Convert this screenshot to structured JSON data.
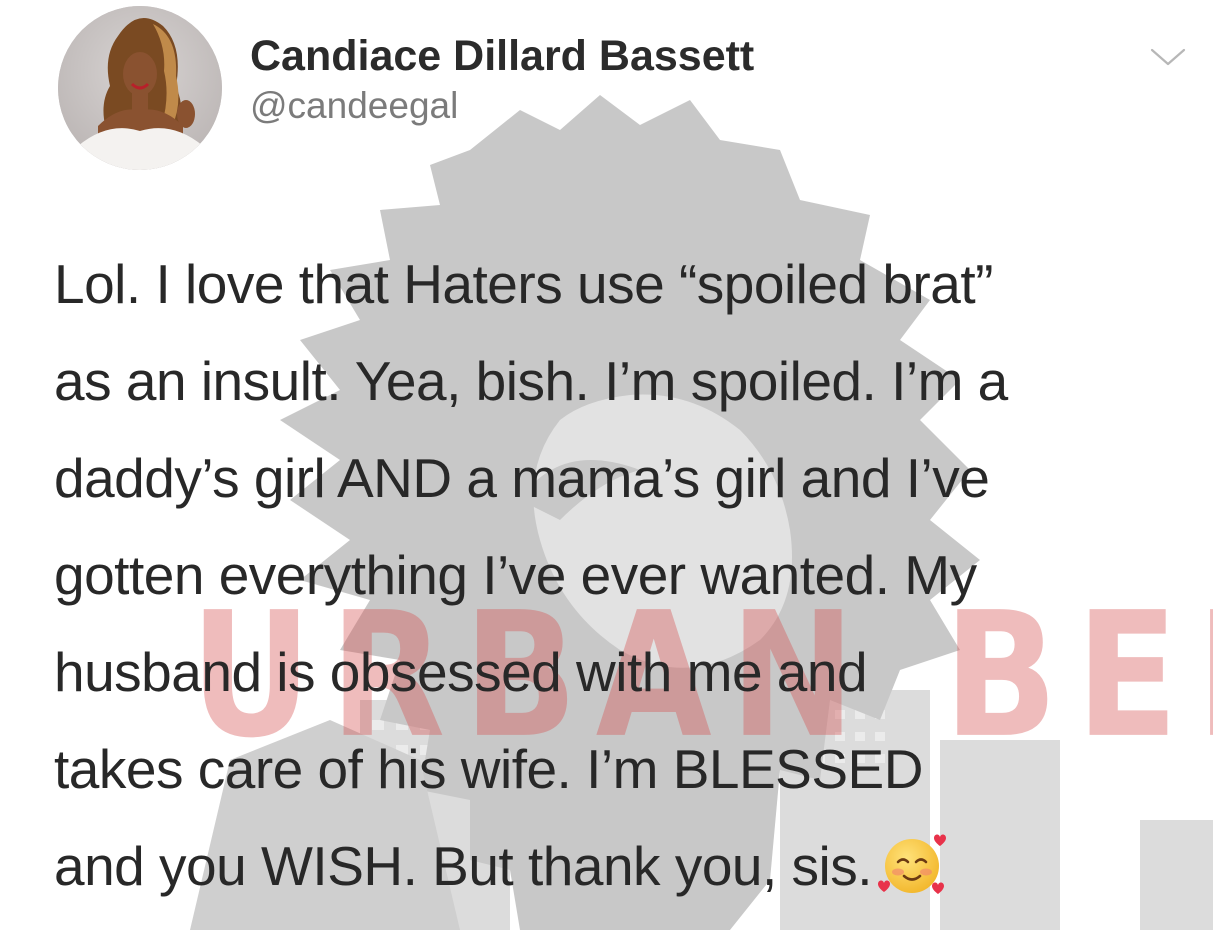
{
  "author": {
    "display_name": "Candiace Dillard Bassett",
    "handle": "@candeegal"
  },
  "tweet": {
    "lines": [
      "Lol. I love that Haters use “spoiled brat”",
      "as an insult. Yea, bish. I’m spoiled. I’m a",
      "daddy’s girl AND a mama’s girl and I’ve",
      "gotten everything I’ve ever wanted. My",
      "husband is obsessed with me and",
      "takes care of his wife. I’m BLESSED",
      "and you WISH. But thank you, sis."
    ],
    "trailing_emoji": "smiling-face-with-hearts-icon"
  },
  "watermark": {
    "text": "URBAN BELLE"
  },
  "icons": {
    "menu": "chevron-down-icon"
  },
  "colors": {
    "text": "#282828",
    "handle": "#7b7b7b",
    "watermark_red": "#d65050",
    "watermark_gray": "#c4c4c4"
  }
}
